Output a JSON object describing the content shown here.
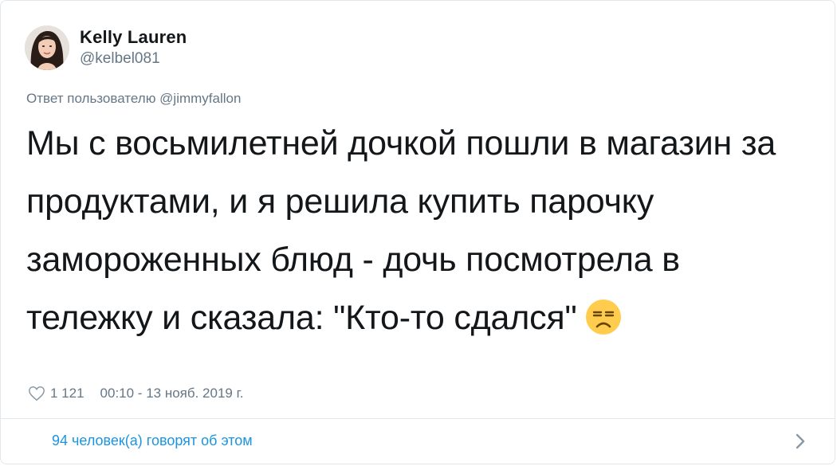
{
  "author": {
    "display_name": "Kelly Lauren",
    "handle": "@kelbel081"
  },
  "reply_to": "Ответ пользователю @jimmyfallon",
  "tweet": {
    "text": "Мы с восьмилетней дочкой пошли в магазин за продуктами, и я решила купить парочку замороженных блюд - дочь посмотрела в тележку и сказала: \"Кто-то сдался\"",
    "emoji": "unamused-face-icon"
  },
  "meta": {
    "likes": "1 121",
    "timestamp": "00:10 - 13 нояб. 2019 г."
  },
  "footer": {
    "conversation_link": "94 человек(а) говорят об этом"
  },
  "colors": {
    "link": "#1b95e0",
    "muted": "#657786",
    "text": "#14171a",
    "border": "#e1e8ed"
  }
}
